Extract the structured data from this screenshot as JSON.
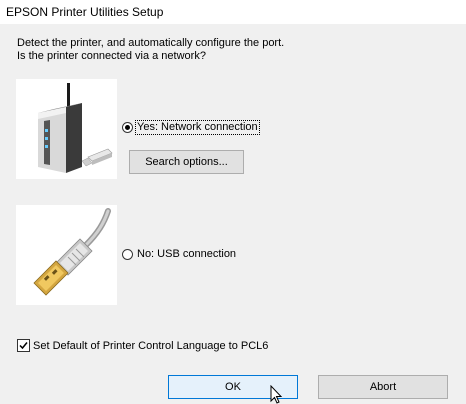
{
  "window": {
    "title": "EPSON Printer Utilities Setup"
  },
  "prompt": {
    "line1": "Detect the printer, and automatically configure the port.",
    "line2": "Is the printer connected via a network?"
  },
  "options": {
    "network": {
      "label": "Yes: Network connection",
      "selected": true,
      "icon": "wireless-router-icon"
    },
    "usb": {
      "label": "No: USB connection",
      "selected": false,
      "icon": "usb-cable-icon"
    }
  },
  "search_button": {
    "label": "Search options..."
  },
  "checkbox": {
    "label": "Set Default of Printer Control Language to PCL6",
    "checked": true
  },
  "buttons": {
    "ok_label": "OK",
    "abort_label": "Abort"
  },
  "colors": {
    "background": "#f0f0f0",
    "focus_border": "#0078d7",
    "button_face": "#e1e1e1"
  }
}
